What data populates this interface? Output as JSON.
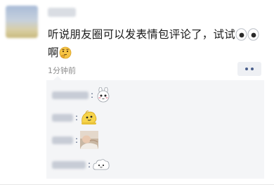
{
  "post": {
    "text_main": "听说朋友圈可以发表情包评论了，试试",
    "text_end": "啊",
    "eyes_emoji": "eyes-emoji",
    "thinking_emoji": "thinking-emoji",
    "time": "1分钟前"
  },
  "actions": {
    "more_icon": "more-dots-icon"
  },
  "comments": [
    {
      "colon": ":",
      "sticker": "white-bunny-sticker"
    },
    {
      "colon": ":",
      "sticker": "yellow-blob-sticker"
    },
    {
      "colon": ":",
      "sticker": "photo-sticker"
    },
    {
      "colon": ":",
      "sticker": "cloud-face-sticker"
    }
  ],
  "colors": {
    "text": "#1a1a1a",
    "name_link": "#3b4b6f",
    "time": "#8c8c8c",
    "comment_bg": "#f4f5f7"
  }
}
